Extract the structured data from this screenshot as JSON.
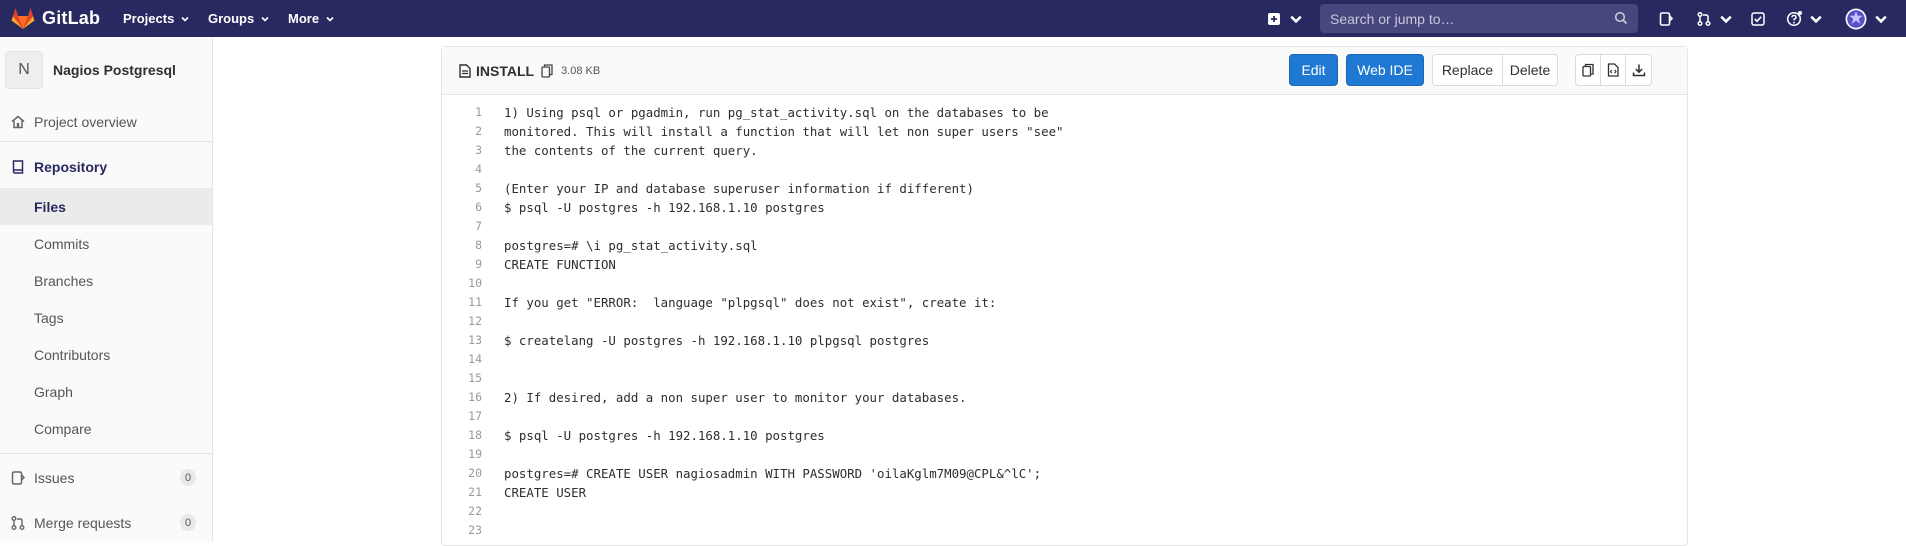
{
  "navbar": {
    "brand": "GitLab",
    "projects_label": "Projects",
    "groups_label": "Groups",
    "more_label": "More",
    "search_placeholder": "Search or jump to…"
  },
  "sidebar": {
    "project_initial": "N",
    "project_name": "Nagios Postgresql",
    "overview_label": "Project overview",
    "repository_label": "Repository",
    "repo_items": [
      "Files",
      "Commits",
      "Branches",
      "Tags",
      "Contributors",
      "Graph",
      "Compare"
    ],
    "issues_label": "Issues",
    "issues_count": "0",
    "mr_label": "Merge requests",
    "mr_count": "0"
  },
  "file": {
    "name": "INSTALL",
    "size": "3.08 KB",
    "edit_label": "Edit",
    "webide_label": "Web IDE",
    "replace_label": "Replace",
    "delete_label": "Delete"
  },
  "code_lines": [
    "1) Using psql or pgadmin, run pg_stat_activity.sql on the databases to be",
    "monitored. This will install a function that will let non super users \"see\"",
    "the contents of the current query.",
    "",
    "(Enter your IP and database superuser information if different)",
    "$ psql -U postgres -h 192.168.1.10 postgres",
    "",
    "postgres=# \\i pg_stat_activity.sql",
    "CREATE FUNCTION",
    "",
    "If you get \"ERROR:  language \"plpgsql\" does not exist\", create it:",
    "",
    "$ createlang -U postgres -h 192.168.1.10 plpgsql postgres",
    "",
    "",
    "2) If desired, add a non super user to monitor your databases.",
    "",
    "$ psql -U postgres -h 192.168.1.10 postgres",
    "",
    "postgres=# CREATE USER nagiosadmin WITH PASSWORD 'oilaKglm7M09@CPL&^lC';",
    "CREATE USER",
    "",
    ""
  ],
  "line_numbers": [
    "1",
    "2",
    "3",
    "4",
    "5",
    "6",
    "7",
    "8",
    "9",
    "10",
    "11",
    "12",
    "13",
    "14",
    "15",
    "16",
    "17",
    "18",
    "19",
    "20",
    "21",
    "22",
    "23"
  ],
  "colors": {
    "navbar_bg": "#292961",
    "primary_button": "#1f78d1",
    "sidebar_active_text": "#292961"
  }
}
